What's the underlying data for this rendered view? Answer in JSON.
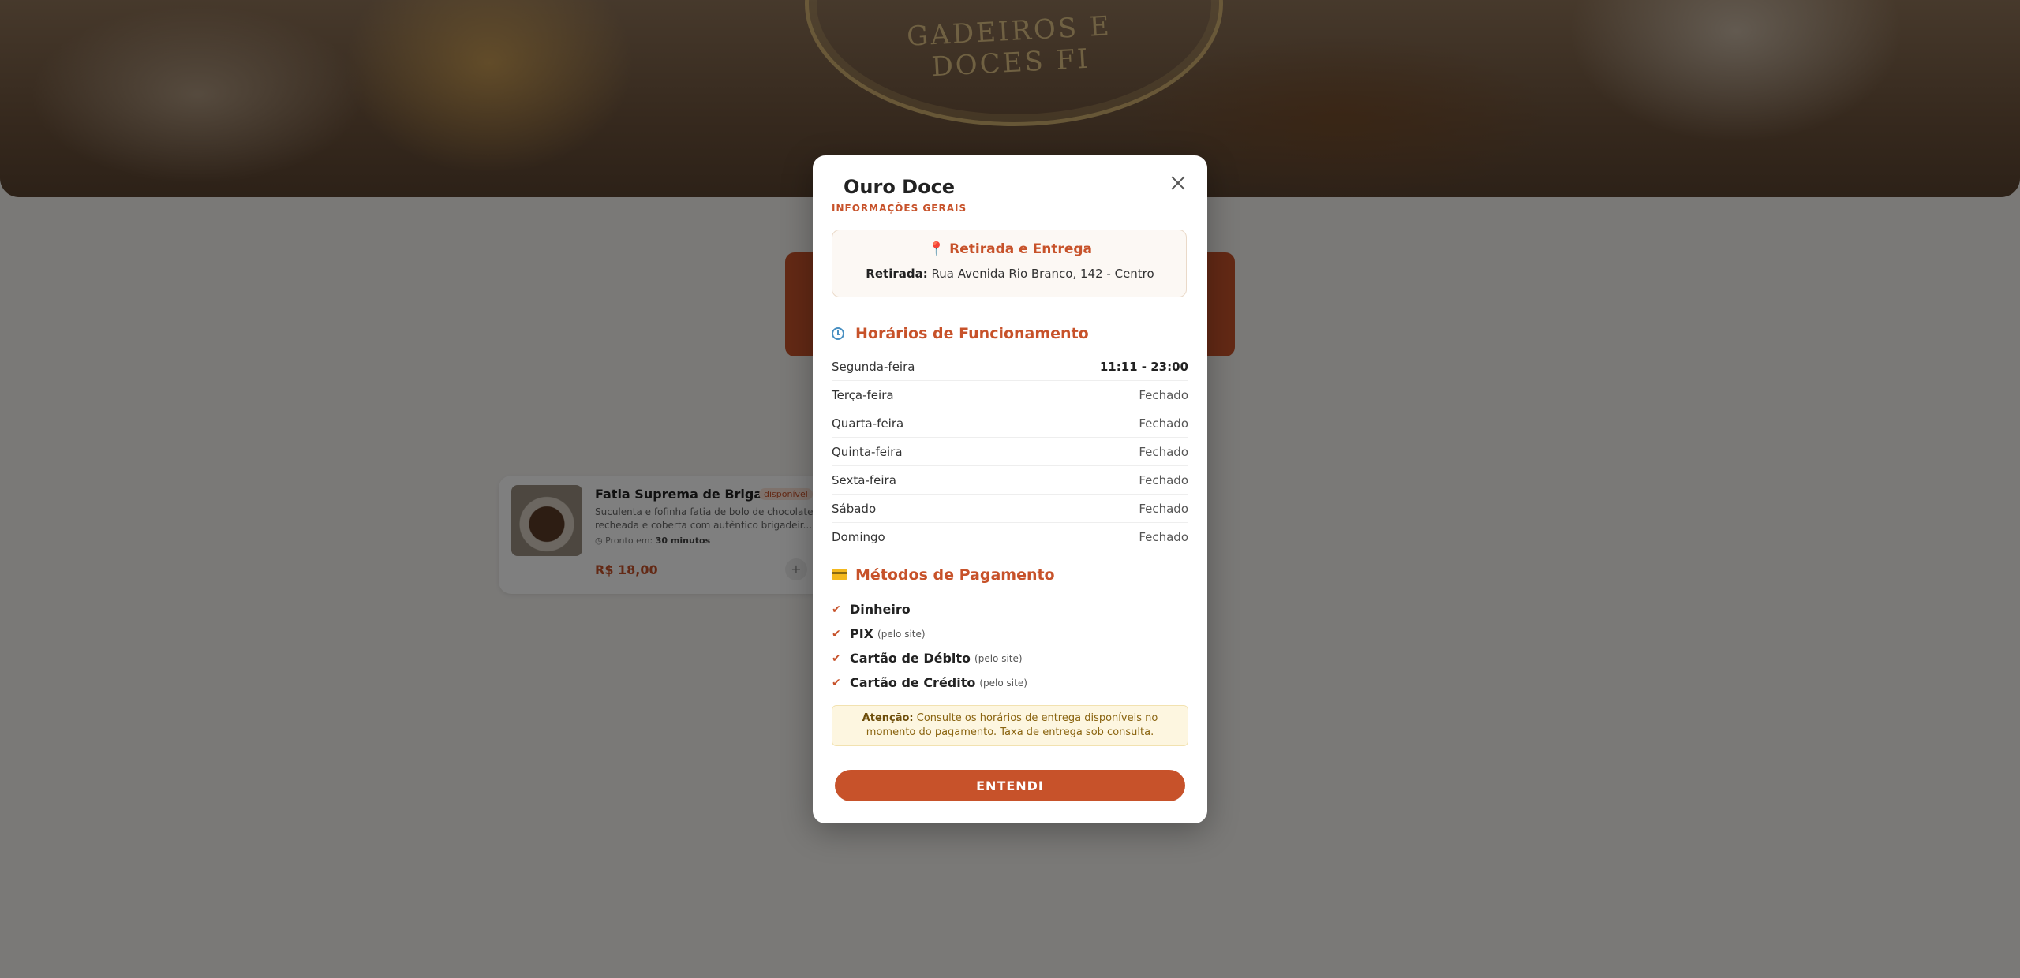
{
  "background": {
    "hero_logo_text": "GADEIROS E DOCES FI",
    "product": {
      "name": "Fatia Suprema de Brigad...",
      "badge": "disponível",
      "description": "Suculenta e fofinha fatia de bolo de chocolate recheada e coberta com autêntico brigadeir...",
      "ready_label": "Pronto em:",
      "ready_value": "30 minutos",
      "price": "R$ 18,00",
      "add_label": "+"
    }
  },
  "modal": {
    "title": "Ouro Doce",
    "subtitle": "INFORMAÇÕES GERAIS",
    "close_icon": "close-icon",
    "pickup": {
      "icon": "📍",
      "title": "Retirada e Entrega",
      "label": "Retirada:",
      "address": "Rua Avenida Rio Branco, 142 - Centro"
    },
    "hours": {
      "title": "Horários de Funcionamento",
      "icon": "clock-icon",
      "days": [
        {
          "day": "Segunda-feira",
          "hours": "11:11 - 23:00"
        },
        {
          "day": "Terça-feira",
          "hours": "Fechado"
        },
        {
          "day": "Quarta-feira",
          "hours": "Fechado"
        },
        {
          "day": "Quinta-feira",
          "hours": "Fechado"
        },
        {
          "day": "Sexta-feira",
          "hours": "Fechado"
        },
        {
          "day": "Sábado",
          "hours": "Fechado"
        },
        {
          "day": "Domingo",
          "hours": "Fechado"
        }
      ]
    },
    "payment": {
      "title": "Métodos de Pagamento",
      "icon": "credit-card-icon",
      "methods": [
        {
          "name": "Dinheiro",
          "note": ""
        },
        {
          "name": "PIX",
          "note": "(pelo site)"
        },
        {
          "name": "Cartão de Débito",
          "note": "(pelo site)"
        },
        {
          "name": "Cartão de Crédito",
          "note": "(pelo site)"
        }
      ]
    },
    "warning": {
      "label": "Atenção:",
      "text": "Consulte os horários de entrega disponíveis no momento do pagamento. Taxa de entrega sob consulta."
    },
    "confirm_label": "ENTENDI"
  },
  "colors": {
    "accent": "#c7522a",
    "warning_bg": "#fdf6e0",
    "overlay": "rgba(0,0,0,0.5)"
  }
}
